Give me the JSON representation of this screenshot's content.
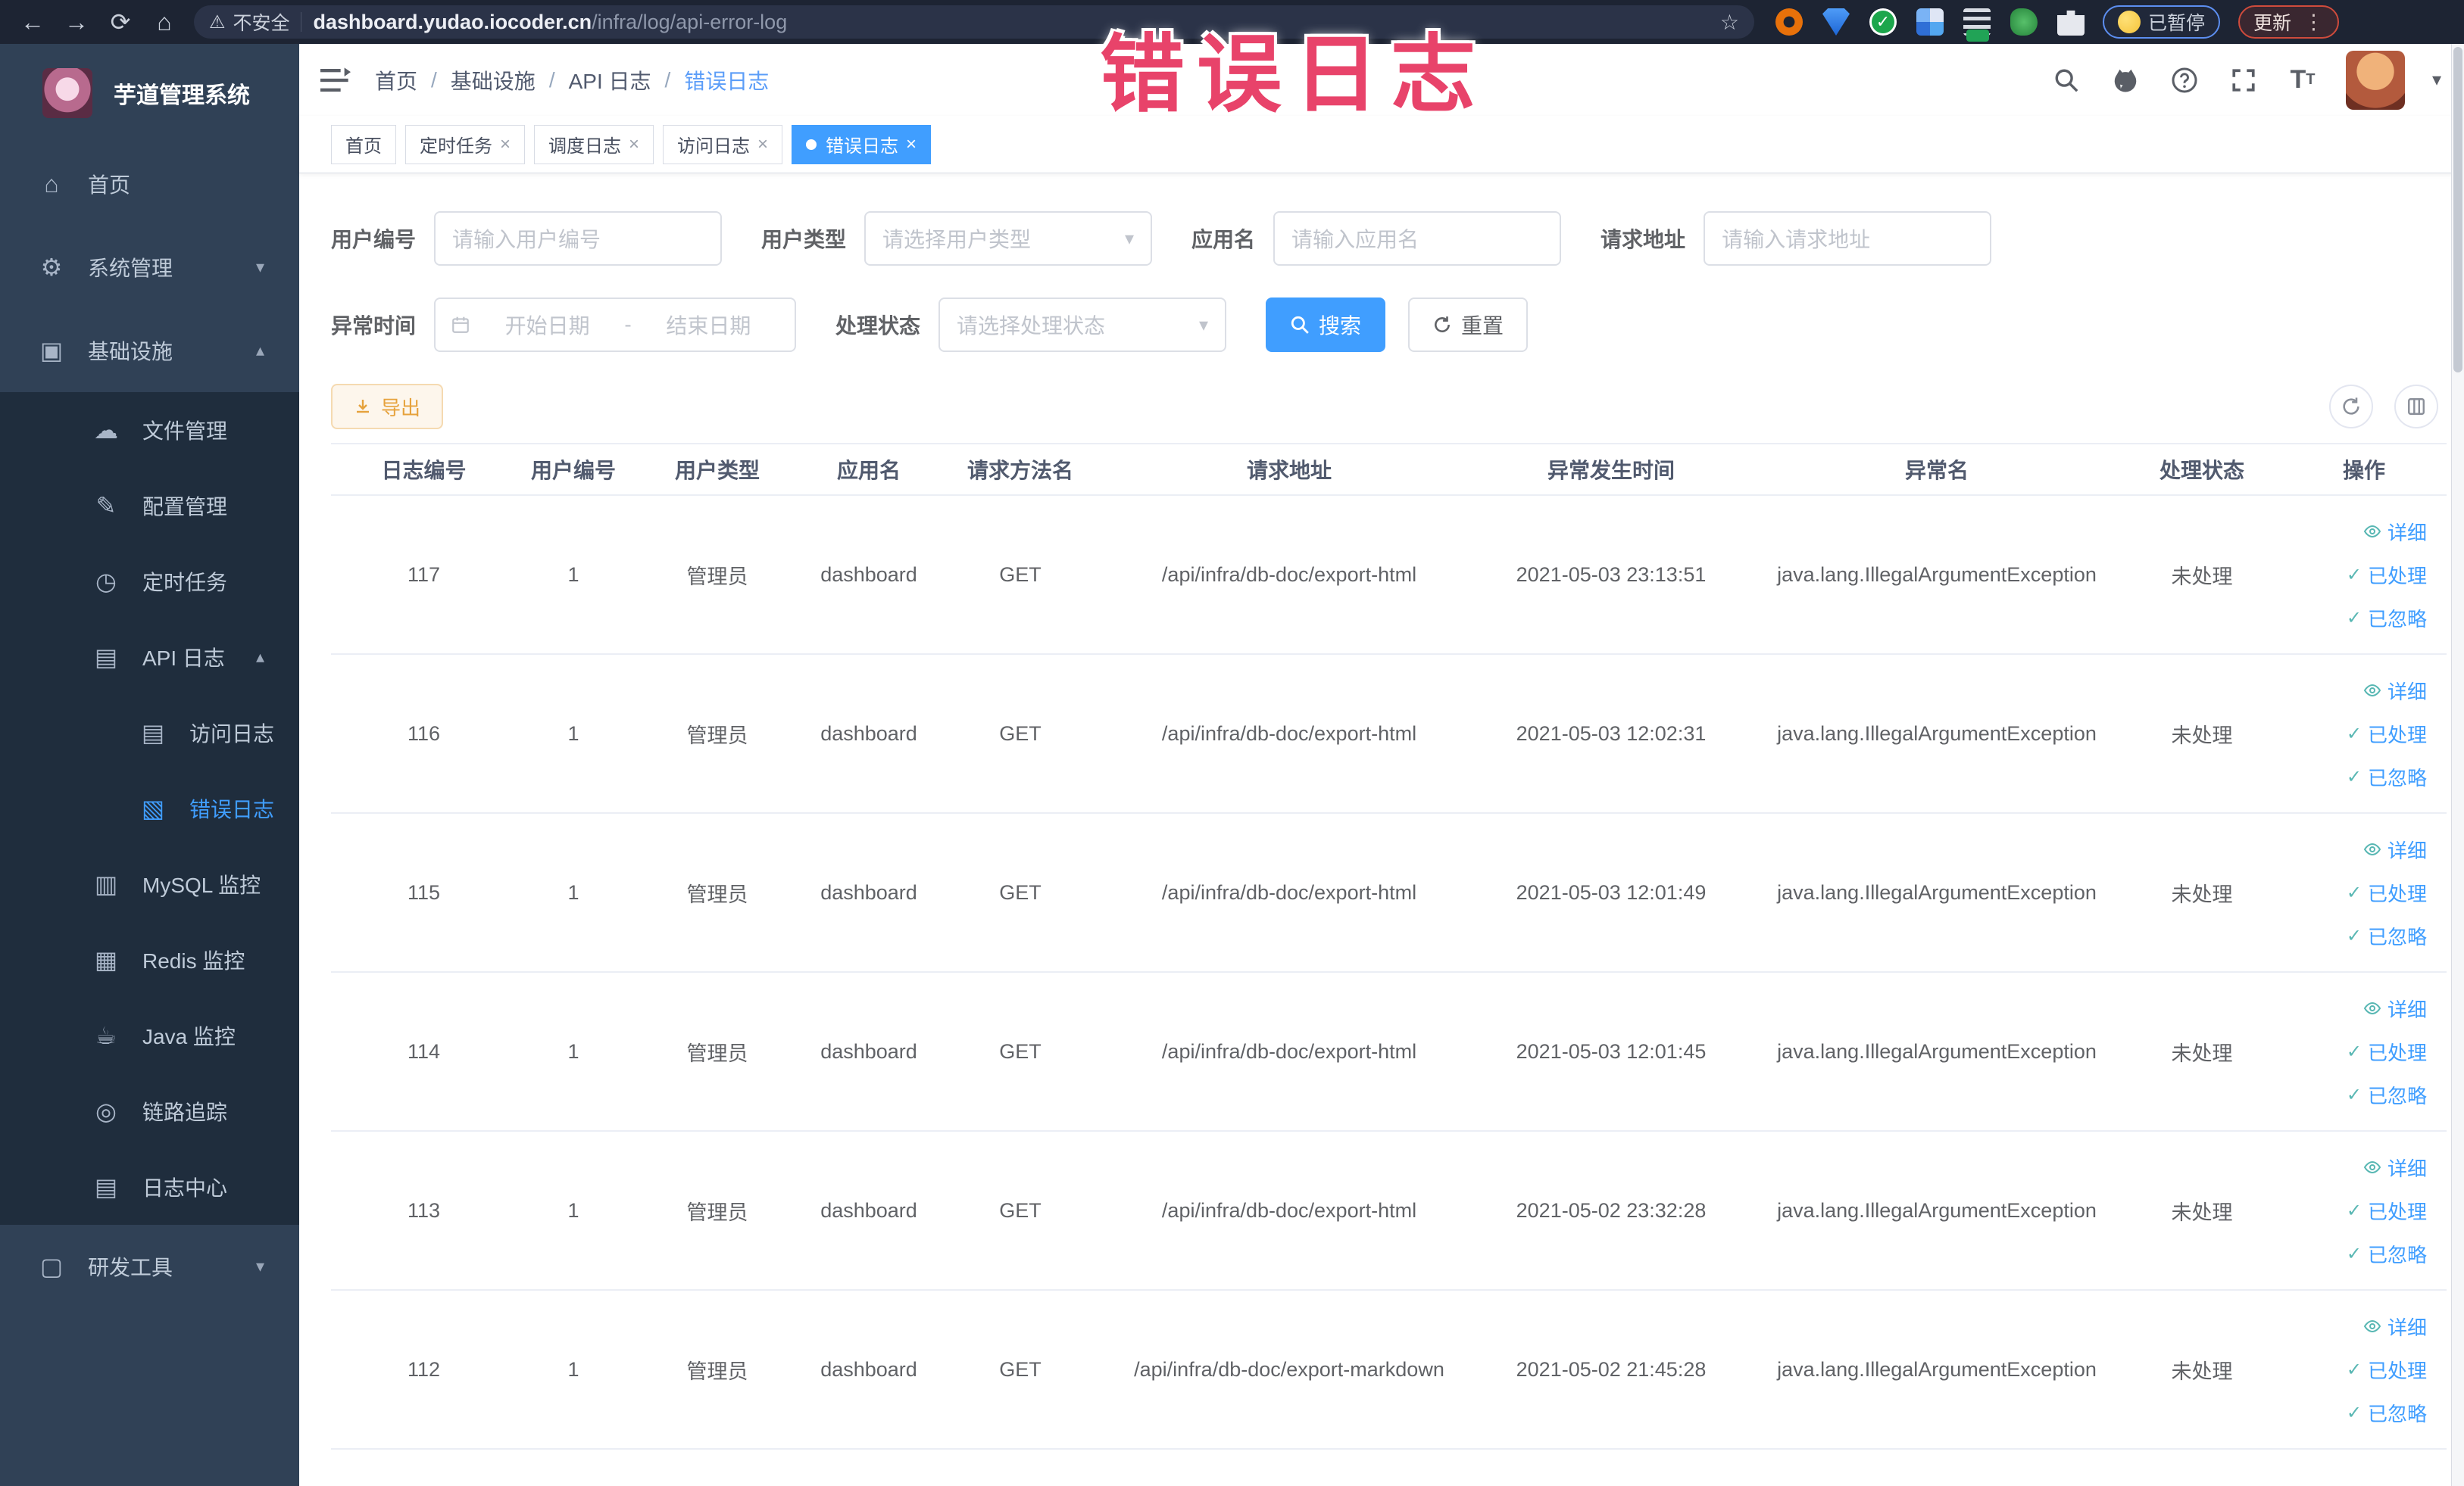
{
  "colors": {
    "accent": "#409eff",
    "warning": "#e6a23c",
    "overlay_red": "#e8436a",
    "sidebar_bg": "#304156",
    "submenu_bg": "#1f2d3d"
  },
  "overlay": {
    "title": "错误日志"
  },
  "browser": {
    "security_label": "不安全",
    "url_domain": "dashboard.yudao.iocoder.cn",
    "url_path": "/infra/log/api-error-log",
    "paused_label": "已暂停",
    "update_label": "更新"
  },
  "header": {
    "breadcrumbs": [
      "首页",
      "基础设施",
      "API 日志",
      "错误日志"
    ],
    "breadcrumb_separator": "/"
  },
  "sidebar": {
    "logo_title": "芋道管理系统",
    "items": [
      {
        "key": "home",
        "label": "首页",
        "icon": "home-icon",
        "level": 0
      },
      {
        "key": "system-management",
        "label": "系统管理",
        "icon": "gear-icon",
        "level": 0,
        "chevron": "down"
      },
      {
        "key": "infrastructure",
        "label": "基础设施",
        "icon": "infrastructure-icon",
        "level": 0,
        "chevron": "up"
      },
      {
        "key": "file-management",
        "label": "文件管理",
        "icon": "cloud-upload-icon",
        "level": 1
      },
      {
        "key": "config-management",
        "label": "配置管理",
        "icon": "edit-icon",
        "level": 1
      },
      {
        "key": "scheduled-tasks",
        "label": "定时任务",
        "icon": "schedule-icon",
        "level": 1
      },
      {
        "key": "api-log",
        "label": "API 日志",
        "icon": "api-log-icon",
        "level": 1,
        "chevron": "up"
      },
      {
        "key": "access-log",
        "label": "访问日志",
        "icon": "access-log-icon",
        "level": 2
      },
      {
        "key": "error-log",
        "label": "错误日志",
        "icon": "error-log-icon",
        "level": 2,
        "active": true
      },
      {
        "key": "mysql-monitor",
        "label": "MySQL 监控",
        "icon": "mysql-monitor-icon",
        "level": 1
      },
      {
        "key": "redis-monitor",
        "label": "Redis 监控",
        "icon": "redis-monitor-icon",
        "level": 1
      },
      {
        "key": "java-monitor",
        "label": "Java 监控",
        "icon": "java-monitor-icon",
        "level": 1
      },
      {
        "key": "link-trace",
        "label": "链路追踪",
        "icon": "trace-icon",
        "level": 1
      },
      {
        "key": "log-center",
        "label": "日志中心",
        "icon": "log-center-icon",
        "level": 1
      },
      {
        "key": "dev-tools",
        "label": "研发工具",
        "icon": "dev-tools-icon",
        "level": 0,
        "chevron": "down"
      }
    ]
  },
  "tabs": [
    {
      "key": "home",
      "label": "首页",
      "closable": false,
      "active": false
    },
    {
      "key": "scheduled-tasks",
      "label": "定时任务",
      "closable": true,
      "active": false
    },
    {
      "key": "schedule-log",
      "label": "调度日志",
      "closable": true,
      "active": false
    },
    {
      "key": "access-log",
      "label": "访问日志",
      "closable": true,
      "active": false
    },
    {
      "key": "error-log",
      "label": "错误日志",
      "closable": true,
      "active": true
    }
  ],
  "filters": {
    "row1": [
      {
        "key": "user-id",
        "label": "用户编号",
        "type": "input",
        "placeholder": "请输入用户编号"
      },
      {
        "key": "user-type",
        "label": "用户类型",
        "type": "select",
        "placeholder": "请选择用户类型"
      },
      {
        "key": "app-name",
        "label": "应用名",
        "type": "input",
        "placeholder": "请输入应用名"
      },
      {
        "key": "request-url",
        "label": "请求地址",
        "type": "input",
        "placeholder": "请输入请求地址"
      }
    ],
    "row2": {
      "time_label": "异常时间",
      "date_start_placeholder": "开始日期",
      "date_separator": "-",
      "date_end_placeholder": "结束日期",
      "status_label": "处理状态",
      "status_placeholder": "请选择处理状态",
      "search_label": "搜索",
      "reset_label": "重置"
    }
  },
  "toolbar": {
    "export_label": "导出"
  },
  "table": {
    "headers": [
      "日志编号",
      "用户编号",
      "用户类型",
      "应用名",
      "请求方法名",
      "请求地址",
      "异常发生时间",
      "异常名",
      "处理状态",
      "操作"
    ],
    "action_labels": [
      "详细",
      "已处理",
      "已忽略"
    ],
    "rows": [
      {
        "id": "117",
        "user_id": "1",
        "user_type": "管理员",
        "app": "dashboard",
        "method": "GET",
        "url": "/api/infra/db-doc/export-html",
        "time": "2021-05-03 23:13:51",
        "exception": "java.lang.IllegalArgumentException",
        "status": "未处理"
      },
      {
        "id": "116",
        "user_id": "1",
        "user_type": "管理员",
        "app": "dashboard",
        "method": "GET",
        "url": "/api/infra/db-doc/export-html",
        "time": "2021-05-03 12:02:31",
        "exception": "java.lang.IllegalArgumentException",
        "status": "未处理"
      },
      {
        "id": "115",
        "user_id": "1",
        "user_type": "管理员",
        "app": "dashboard",
        "method": "GET",
        "url": "/api/infra/db-doc/export-html",
        "time": "2021-05-03 12:01:49",
        "exception": "java.lang.IllegalArgumentException",
        "status": "未处理"
      },
      {
        "id": "114",
        "user_id": "1",
        "user_type": "管理员",
        "app": "dashboard",
        "method": "GET",
        "url": "/api/infra/db-doc/export-html",
        "time": "2021-05-03 12:01:45",
        "exception": "java.lang.IllegalArgumentException",
        "status": "未处理"
      },
      {
        "id": "113",
        "user_id": "1",
        "user_type": "管理员",
        "app": "dashboard",
        "method": "GET",
        "url": "/api/infra/db-doc/export-html",
        "time": "2021-05-02 23:32:28",
        "exception": "java.lang.IllegalArgumentException",
        "status": "未处理"
      },
      {
        "id": "112",
        "user_id": "1",
        "user_type": "管理员",
        "app": "dashboard",
        "method": "GET",
        "url": "/api/infra/db-doc/export-markdown",
        "time": "2021-05-02 21:45:28",
        "exception": "java.lang.IllegalArgumentException",
        "status": "未处理"
      }
    ]
  }
}
